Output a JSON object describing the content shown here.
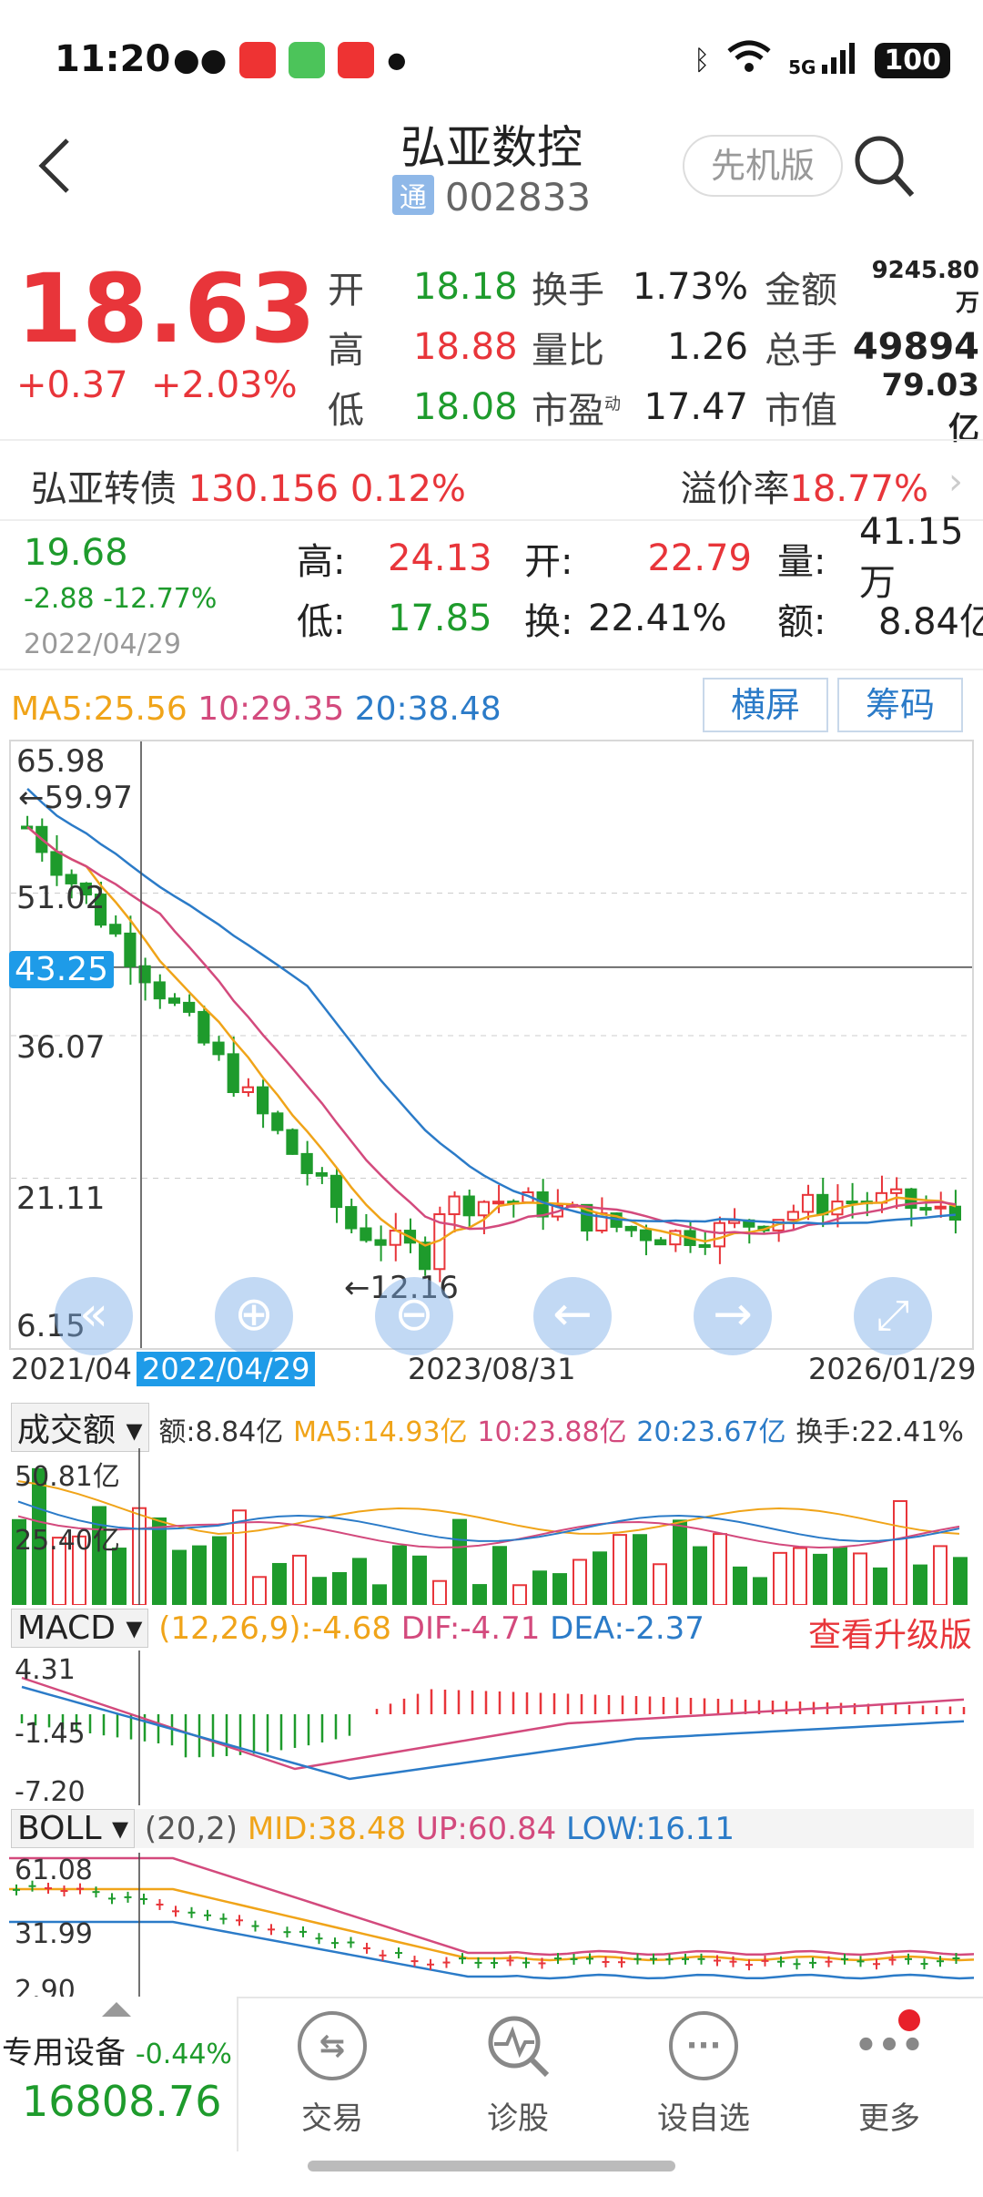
{
  "status": {
    "time": "11:20",
    "battery": "100",
    "network": "5G"
  },
  "header": {
    "title": "弘亚数控",
    "badge": "通",
    "code": "002833",
    "mode_button": "先机版"
  },
  "quote": {
    "price": "18.63",
    "change": "+0.37",
    "change_pct": "+2.03%",
    "open_label": "开",
    "open": "18.18",
    "high_label": "高",
    "high": "18.88",
    "low_label": "低",
    "low": "18.08",
    "turnover_label": "换手",
    "turnover": "1.73%",
    "volume_ratio_label": "量比",
    "volume_ratio": "1.26",
    "pe_label": "市盈",
    "pe_sup": "动",
    "pe": "17.47",
    "amount_label": "金额",
    "amount": "9245.80万",
    "total_hands_label": "总手",
    "total_hands": "49894",
    "market_cap_label": "市值",
    "market_cap": "79.03亿"
  },
  "bond": {
    "name": "弘亚转债",
    "price": "130.156",
    "pct": "0.12%",
    "premium_label": "溢价率",
    "premium": "18.77%"
  },
  "day_detail": {
    "price": "19.68",
    "change": "-2.88",
    "change_pct": "-12.77%",
    "date": "2022/04/29",
    "high_label": "高:",
    "high": "24.13",
    "open_label": "开:",
    "open": "22.79",
    "vol_label": "量:",
    "vol": "41.15万",
    "low_label": "低:",
    "low": "17.85",
    "turn_label": "换:",
    "turn": "22.41%",
    "amt_label": "额:",
    "amt": "8.84亿"
  },
  "ma_legend": {
    "ma5": "MA5:25.56",
    "ma10": "10:29.35",
    "ma20": "20:38.48"
  },
  "chart_buttons": {
    "landscape": "横屏",
    "chips": "筹码"
  },
  "kline": {
    "y_labels": [
      "65.98",
      "51.02",
      "36.07",
      "21.11",
      "6.15"
    ],
    "cursor_value": "43.25",
    "high_marker": "←59.97",
    "low_marker": "←12.16",
    "x_labels": [
      "2021/04",
      "2023/08/31",
      "2026/01/29"
    ],
    "cursor_date": "2022/04/29"
  },
  "volume_panel": {
    "selector": "成交额",
    "amount": "额:8.84亿",
    "ma5": "MA5:14.93亿",
    "ma10": "10:23.88亿",
    "ma20": "20:23.67亿",
    "turnover": "换手:22.41%",
    "y_top": "50.81亿",
    "y_mid": "25.40亿"
  },
  "macd_panel": {
    "selector": "MACD",
    "macd": "(12,26,9):-4.68",
    "dif": "DIF:-4.71",
    "dea": "DEA:-2.37",
    "upgrade": "查看升级版",
    "y_labels": [
      "4.31",
      "-1.45",
      "-7.20"
    ]
  },
  "boll_panel": {
    "selector": "BOLL",
    "params": "(20,2)",
    "mid": "MID:38.48",
    "up": "UP:60.84",
    "low": "LOW:16.11",
    "y_labels": [
      "61.08",
      "31.99",
      "2.90"
    ]
  },
  "bottom_nav": {
    "index_name": "专用设备",
    "index_pct": "-0.44%",
    "index_value": "16808.76",
    "items": [
      {
        "label": "交易"
      },
      {
        "label": "诊股"
      },
      {
        "label": "设自选"
      },
      {
        "label": "更多"
      }
    ]
  },
  "colors": {
    "up": "#e8353a",
    "down": "#1e9b2c",
    "ma5": "#f0a419",
    "ma10": "#d34a7d",
    "ma20": "#2b7bc8"
  }
}
